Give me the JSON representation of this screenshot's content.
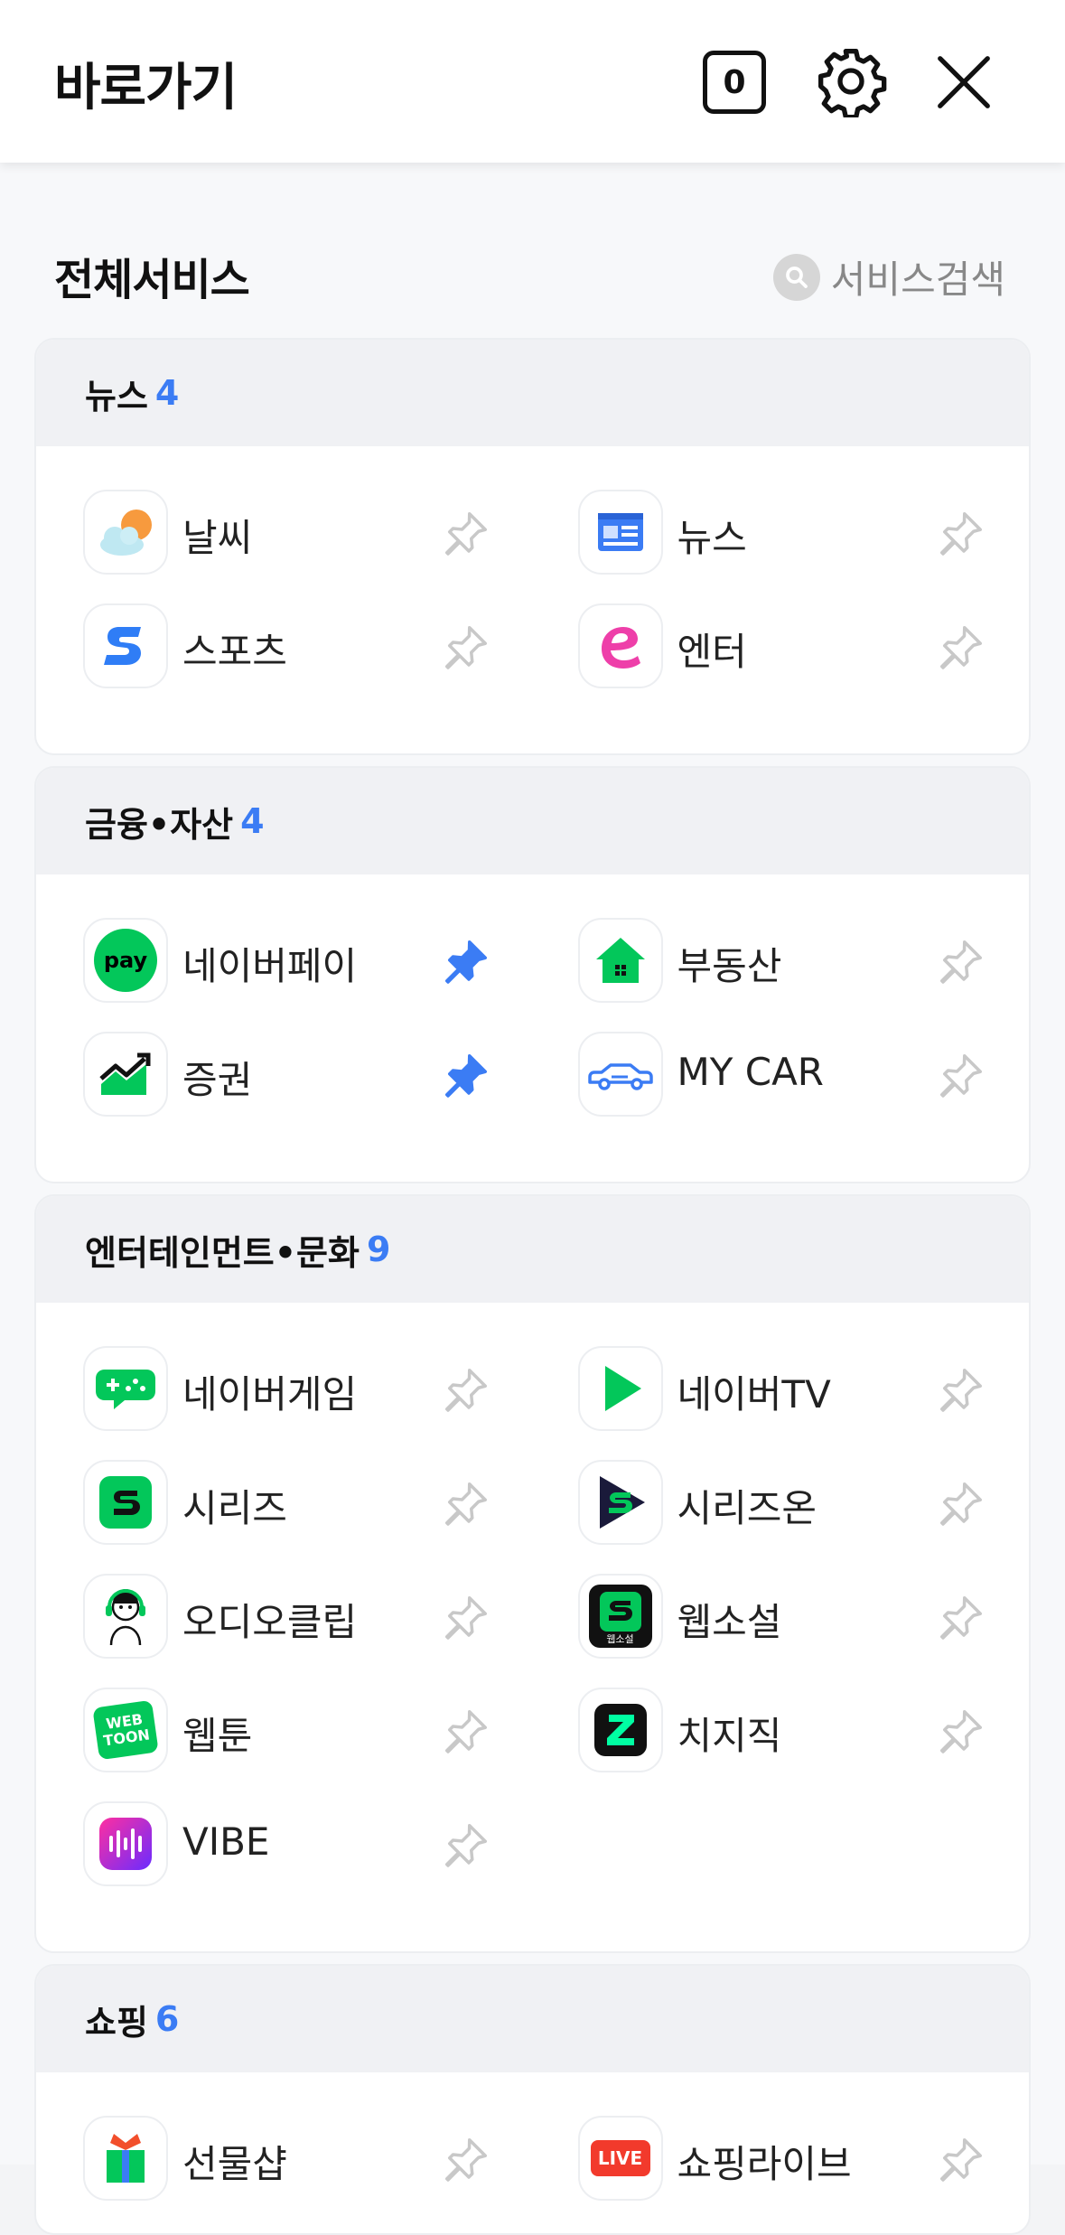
{
  "header": {
    "title": "바로가기",
    "badge": "0"
  },
  "services": {
    "heading": "전체서비스",
    "search_label": "서비스검색"
  },
  "categories": [
    {
      "name": "뉴스",
      "count": "4",
      "items": [
        {
          "label": "날씨",
          "icon": "weather-icon",
          "pinned": false
        },
        {
          "label": "뉴스",
          "icon": "news-icon",
          "pinned": false
        },
        {
          "label": "스포츠",
          "icon": "sports-icon",
          "pinned": false
        },
        {
          "label": "엔터",
          "icon": "enter-icon",
          "pinned": false
        }
      ]
    },
    {
      "name": "금융•자산",
      "count": "4",
      "items": [
        {
          "label": "네이버페이",
          "icon": "naverpay-icon",
          "pinned": true
        },
        {
          "label": "부동산",
          "icon": "realestate-icon",
          "pinned": false
        },
        {
          "label": "증권",
          "icon": "stock-icon",
          "pinned": true
        },
        {
          "label": "MY CAR",
          "icon": "car-icon",
          "pinned": false
        }
      ]
    },
    {
      "name": "엔터테인먼트•문화",
      "count": "9",
      "items": [
        {
          "label": "네이버게임",
          "icon": "game-icon",
          "pinned": false
        },
        {
          "label": "네이버TV",
          "icon": "navertv-icon",
          "pinned": false
        },
        {
          "label": "시리즈",
          "icon": "series-icon",
          "pinned": false
        },
        {
          "label": "시리즈온",
          "icon": "serieson-icon",
          "pinned": false
        },
        {
          "label": "오디오클립",
          "icon": "audioclip-icon",
          "pinned": false
        },
        {
          "label": "웹소설",
          "icon": "webnovel-icon",
          "pinned": false
        },
        {
          "label": "웹툰",
          "icon": "webtoon-icon",
          "pinned": false
        },
        {
          "label": "치지직",
          "icon": "chzzk-icon",
          "pinned": false
        },
        {
          "label": "VIBE",
          "icon": "vibe-icon",
          "pinned": false
        }
      ]
    },
    {
      "name": "쇼핑",
      "count": "6",
      "items": [
        {
          "label": "선물샵",
          "icon": "giftshop-icon",
          "pinned": false
        },
        {
          "label": "쇼핑라이브",
          "icon": "shoppinglive-icon",
          "pinned": false
        }
      ]
    }
  ],
  "icon_texts": {
    "pay": "pay",
    "webtoon_top": "WEB",
    "webtoon_bottom": "TOON",
    "live": "LIVE",
    "webnovel": "웹소설"
  },
  "colors": {
    "accent": "#3b7cf4",
    "naver_green": "#03c75a",
    "pin_inactive": "#c8c8c8"
  }
}
